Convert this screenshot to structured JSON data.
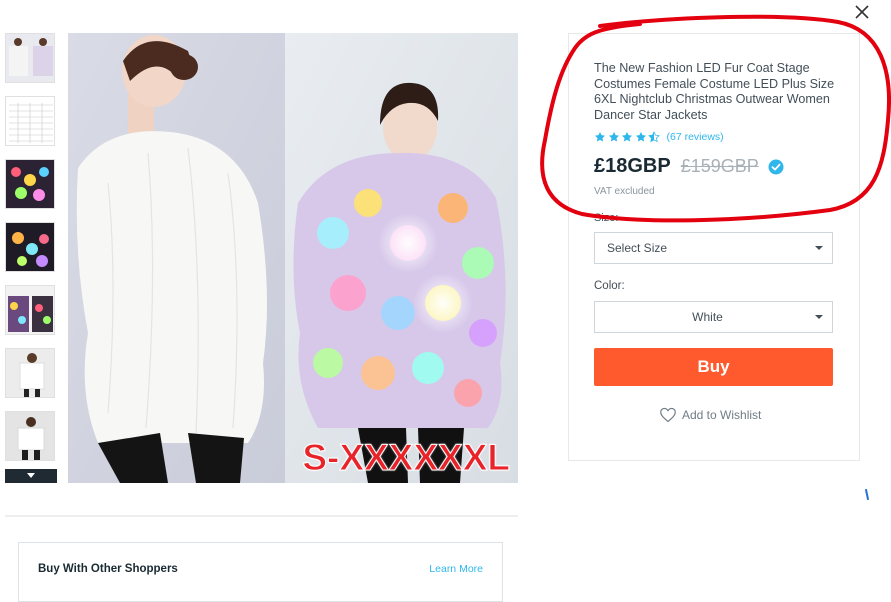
{
  "product": {
    "title": "The New Fashion LED Fur Coat Stage Costumes Female Costume LED Plus Size 6XL Nightclub Christmas Outwear Women Dancer Star Jackets",
    "rating": 4.5,
    "rating_max": 5,
    "reviews": "(67 reviews)",
    "price": "£18GBP",
    "old_price": "£159GBP",
    "vat_note": "VAT excluded",
    "size_label": "Size:",
    "size_value": "Select Size",
    "color_label": "Color:",
    "color_value": "White",
    "buy_label": "Buy",
    "wishlist_label": "Add to Wishlist"
  },
  "gallery": {
    "overlay_text": "S-XXXXXXL",
    "thumbnails": [
      "photo-white-and-led",
      "size-chart",
      "led-coat-lit",
      "led-coat-lit-2",
      "led-coat-pair",
      "model-white-coat",
      "model-white-coat-2"
    ]
  },
  "buy_with": {
    "title": "Buy With Other Shoppers",
    "learn_more": "Learn More"
  },
  "colors": {
    "buy_button": "#ff5a2d",
    "link": "#2fb7ec",
    "star": "#2fb7ec",
    "annotation_circle": "#e3000f",
    "overlay_text": "#e8242a"
  },
  "icons": {
    "close": "close-icon",
    "verified": "verified-check-icon",
    "heart": "heart-icon",
    "caret": "chevron-down-icon"
  }
}
